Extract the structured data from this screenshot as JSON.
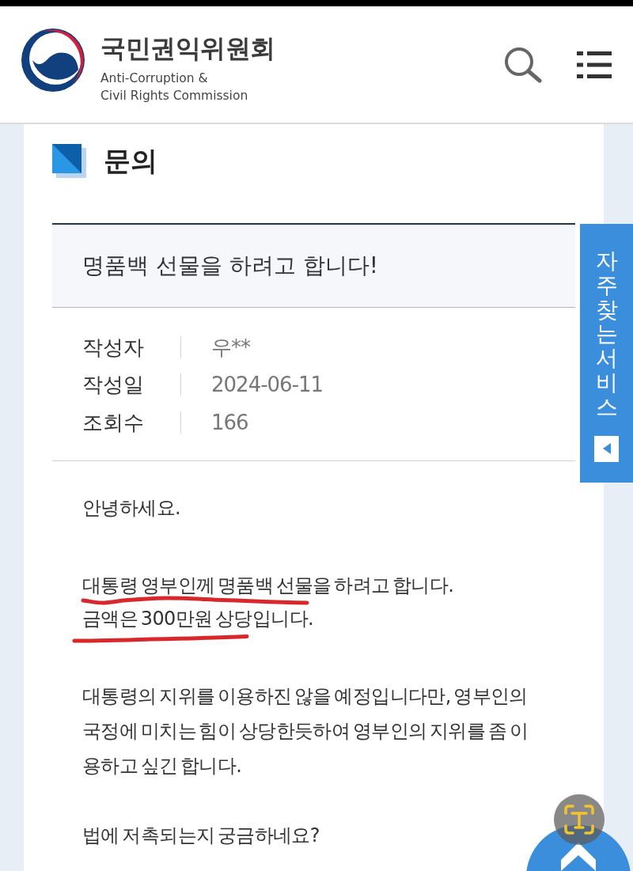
{
  "header": {
    "title": "국민권익위원회",
    "subtitle_lines": [
      "Anti-Corruption &",
      "Civil Rights Commission"
    ]
  },
  "section": {
    "title": "문의"
  },
  "post": {
    "title": "명품백 선물을 하려고 합니다!",
    "meta": [
      {
        "label": "작성자",
        "value": "우**"
      },
      {
        "label": "작성일",
        "value": "2024-06-11"
      },
      {
        "label": "조회수",
        "value": "166"
      }
    ],
    "body": [
      {
        "lines": [
          "안녕하세요."
        ]
      },
      {
        "lines": [
          "대통령 영부인께 명품백 선물을 하려고 합니다.",
          "금액은 300만원 상당입니다."
        ]
      },
      {
        "lines": [
          "대통령의 지위를 이용하진 않을 예정입니다만, 영부인의 국정에 미치는 힘이 상당한듯하여 영부인의 지위를 좀 이용하고 싶긴 합니다."
        ]
      },
      {
        "lines": [
          "법에 저촉되는지 궁금하네요?"
        ]
      }
    ]
  },
  "side_tab": {
    "label": "자주 찾는 서비스"
  }
}
